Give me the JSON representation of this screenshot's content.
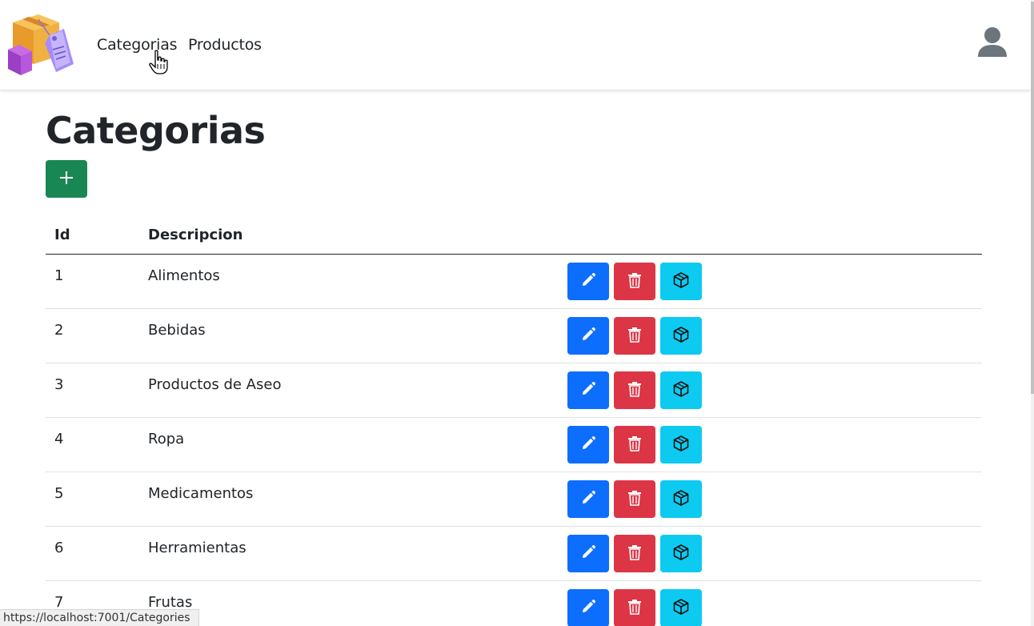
{
  "nav": {
    "links": [
      {
        "label": "Categorias"
      },
      {
        "label": "Productos"
      }
    ],
    "logo_icon": "product-boxes-logo",
    "user_icon": "user-icon"
  },
  "page": {
    "title": "Categorias",
    "add_icon": "plus-icon"
  },
  "table": {
    "headers": {
      "id": "Id",
      "description": "Descripcion"
    },
    "rows": [
      {
        "id": "1",
        "description": "Alimentos"
      },
      {
        "id": "2",
        "description": "Bebidas"
      },
      {
        "id": "3",
        "description": "Productos de Aseo"
      },
      {
        "id": "4",
        "description": "Ropa"
      },
      {
        "id": "5",
        "description": "Medicamentos"
      },
      {
        "id": "6",
        "description": "Herramientas"
      },
      {
        "id": "7",
        "description": "Frutas"
      }
    ],
    "actions": [
      "pencil-icon",
      "trash-icon",
      "box-icon"
    ]
  },
  "status_bar": {
    "url": "https://localhost:7001/Categories"
  },
  "colors": {
    "primary": "#0d6efd",
    "danger": "#dc3545",
    "info": "#0dcaf0",
    "success": "#198754"
  }
}
